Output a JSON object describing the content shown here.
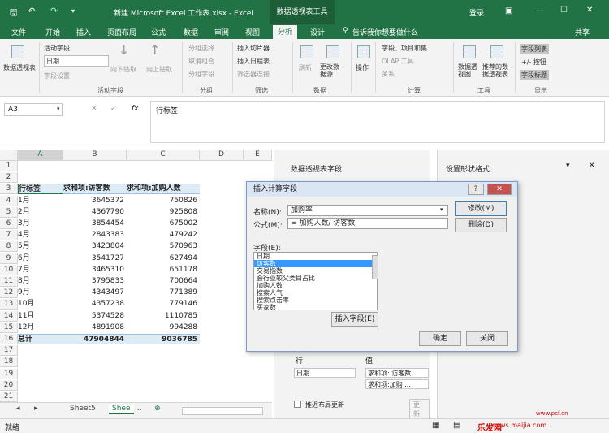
{
  "window": {
    "title": "新建 Microsoft Excel 工作表.xlsx - Excel",
    "context_title": "数据透视表工具",
    "login": "登录",
    "min": "—",
    "max": "☐",
    "close": "✕",
    "restore": "▣"
  },
  "tabs": [
    {
      "label": "文件"
    },
    {
      "label": "开始"
    },
    {
      "label": "插入"
    },
    {
      "label": "页面布局"
    },
    {
      "label": "公式"
    },
    {
      "label": "数据"
    },
    {
      "label": "审阅"
    },
    {
      "label": "视图"
    },
    {
      "label": "分析"
    },
    {
      "label": "设计"
    }
  ],
  "tell_me": "告诉我你想要做什么",
  "share": "共享",
  "ribbon": {
    "pivot_table": "数据透视表",
    "active_field_label": "活动字段:",
    "active_field_value": "日期",
    "field_settings": "字段设置",
    "drill_down": "向下钻取",
    "drill_up": "向上钻取",
    "group_selection": "分组选择",
    "ungroup": "取消组合",
    "group_field": "分组字段",
    "insert_slicer": "插入切片器",
    "insert_timeline": "插入日程表",
    "filter_connections": "筛选器连接",
    "refresh": "刷新",
    "change_source": "更改数据源",
    "actions": "操作",
    "fields_items": "字段、项目和集",
    "olap_tools": "OLAP 工具",
    "relationships": "关系",
    "pivot_chart": "数据透视图",
    "recommended": "推荐的数据透视表",
    "field_list": "字段列表",
    "plus_minus": "+/- 按钮",
    "field_headers": "字段标题",
    "group_labels": {
      "active_field": "活动字段",
      "group": "分组",
      "filter": "筛选",
      "data": "数据",
      "calc": "计算",
      "tools": "工具",
      "show": "显示"
    }
  },
  "formula_bar": {
    "name_box": "A3",
    "cancel": "✕",
    "enter": "✓",
    "fx": "fx",
    "content": "行标签"
  },
  "grid": {
    "columns": [
      "A",
      "B",
      "C",
      "D",
      "E"
    ],
    "rows": [
      {
        "n": "1",
        "a": "",
        "b": "",
        "c": ""
      },
      {
        "n": "2",
        "a": "",
        "b": "",
        "c": ""
      },
      {
        "n": "3",
        "a": "行标签",
        "b": "求和项:访客数",
        "c": "求和项:加购人数"
      },
      {
        "n": "4",
        "a": "1月",
        "b": "3645372",
        "c": "750826"
      },
      {
        "n": "5",
        "a": "2月",
        "b": "4367790",
        "c": "925808"
      },
      {
        "n": "6",
        "a": "3月",
        "b": "3854454",
        "c": "675002"
      },
      {
        "n": "7",
        "a": "4月",
        "b": "2843383",
        "c": "479242"
      },
      {
        "n": "8",
        "a": "5月",
        "b": "3423804",
        "c": "570963"
      },
      {
        "n": "9",
        "a": "6月",
        "b": "3541727",
        "c": "627494"
      },
      {
        "n": "10",
        "a": "7月",
        "b": "3465310",
        "c": "651178"
      },
      {
        "n": "11",
        "a": "8月",
        "b": "3795833",
        "c": "700664"
      },
      {
        "n": "12",
        "a": "9月",
        "b": "4343497",
        "c": "771389"
      },
      {
        "n": "13",
        "a": "10月",
        "b": "4357238",
        "c": "779146"
      },
      {
        "n": "14",
        "a": "11月",
        "b": "5374528",
        "c": "1110785"
      },
      {
        "n": "15",
        "a": "12月",
        "b": "4891908",
        "c": "994288"
      },
      {
        "n": "16",
        "a": "总计",
        "b": "47904844",
        "c": "9036785"
      },
      {
        "n": "17",
        "a": "",
        "b": "",
        "c": ""
      },
      {
        "n": "18",
        "a": "",
        "b": "",
        "c": ""
      },
      {
        "n": "19",
        "a": "",
        "b": "",
        "c": ""
      },
      {
        "n": "20",
        "a": "",
        "b": "",
        "c": ""
      },
      {
        "n": "21",
        "a": "",
        "b": "",
        "c": ""
      }
    ]
  },
  "sheet_tabs": {
    "tab1": "Sheet5",
    "tab2": "Shee",
    "more": "...",
    "add": "⊕"
  },
  "status": {
    "ready": "就绪",
    "watermark": "乐发网",
    "watermark_url": "news.maijia.com",
    "watermark_url2": "www.pcf.cn"
  },
  "pivot_panel": {
    "title": "数据透视表字段",
    "rows_label": "行",
    "values_label": "值",
    "rows_item": "日期",
    "values_item1": "求和项: 访客数",
    "values_item2": "求和项:加购 ...",
    "defer_update": "推迟布局更新",
    "update": "更新"
  },
  "shape_panel": {
    "title": "设置形状格式"
  },
  "dialog": {
    "title": "插入计算字段",
    "help": "?",
    "close": "✕",
    "name_label": "名称(N):",
    "name_value": "加购率",
    "formula_label": "公式(M):",
    "formula_value": "= 加购人数/ 访客数",
    "modify": "修改(M)",
    "delete": "删除(D)",
    "fields_label": "字段(E):",
    "fields": [
      "日期",
      "访客数",
      "交易指数",
      "会行业较父类目占比",
      "加购人数",
      "搜索人气",
      "搜索点击率",
      "买家数"
    ],
    "selected_index": 1,
    "insert_field": "插入字段(E)",
    "ok": "确定",
    "cancel": "关闭"
  }
}
